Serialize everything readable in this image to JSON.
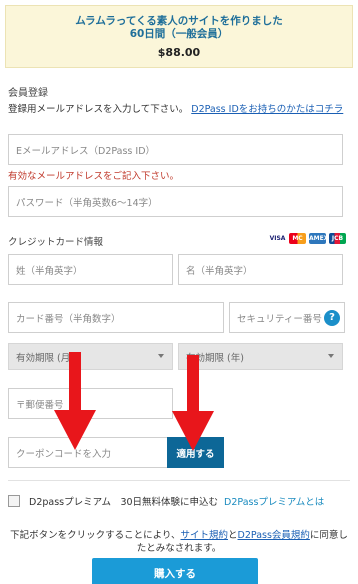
{
  "banner": {
    "title_line1": "ムラムラってくる素人のサイトを作りました",
    "title_line2": "60日間（一般会員）",
    "price": "$88.00"
  },
  "registration": {
    "section_title": "会員登録",
    "intro_text": "登録用メールアドレスを入力して下さい。",
    "intro_link": "D2Pass IDをお持ちのかたはコチラ",
    "email_placeholder": "Eメールアドレス（D2Pass ID）",
    "email_error": "有効なメールアドレスをご記入下さい。",
    "password_placeholder": "パスワード（半角英数6〜14字）"
  },
  "credit_card": {
    "section_title": "クレジットカード情報",
    "card_brands": [
      "VISA",
      "MC",
      "AMEX",
      "JCB"
    ],
    "last_name_placeholder": "姓（半角英字）",
    "first_name_placeholder": "名（半角英字）",
    "card_number_placeholder": "カード番号（半角数字）",
    "security_code_placeholder": "セキュリティー番号",
    "help_icon_label": "?",
    "expiry_month_label": "有効期限 (月)",
    "expiry_year_label": "有効期限 (年)",
    "postal_code_placeholder": "〒郵便番号"
  },
  "coupon": {
    "input_placeholder": "クーポンコードを入力",
    "apply_label": "適用する"
  },
  "premium": {
    "label": "D2passプレミアム　30日無料体験に申込む",
    "link": "D2Passプレミアムとは"
  },
  "terms": {
    "prefix": "下記ボタンをクリックすることにより、",
    "link1": "サイト規約",
    "and": "と",
    "link2": "D2Pass会員規約",
    "suffix": "に同意したとみなされます。"
  },
  "buy_button_label": "購入する",
  "colors": {
    "accent": "#1b9bd7",
    "apply_button": "#0d6797",
    "error": "#c0392b",
    "arrow": "#e8161b",
    "banner_bg": "#fbf6d9"
  }
}
